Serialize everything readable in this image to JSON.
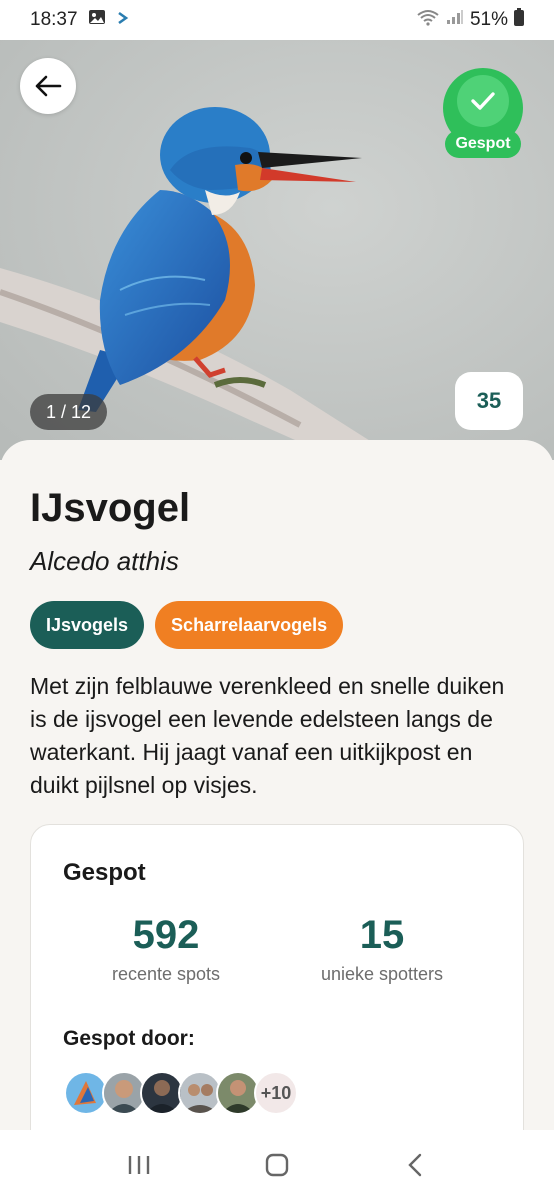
{
  "status_bar": {
    "time": "18:37",
    "battery": "51%",
    "icons": [
      "image-icon",
      "prompt-icon",
      "wifi-icon",
      "signal-icon",
      "battery-icon"
    ]
  },
  "hero": {
    "photo_counter": "1 / 12",
    "photo_count_chip": "35",
    "spotted_badge_label": "Gespot",
    "back_icon": "arrow-left-icon",
    "badge_icon": "check-icon"
  },
  "species": {
    "name": "IJsvogel",
    "latin_name": "Alcedo atthis",
    "tags": [
      {
        "label": "IJsvogels",
        "color": "#1b5e57"
      },
      {
        "label": "Scharrelaarvogels",
        "color": "#f07f22"
      }
    ],
    "description": "Met zijn felblauwe verenkleed en snelle duiken is de ijsvogel een levende edelsteen langs de waterkant. Hij jaagt vanaf een uitkijkpost en duikt pijlsnel op visjes."
  },
  "spotted_card": {
    "title": "Gespot",
    "stats": [
      {
        "value": "592",
        "label": "recente spots"
      },
      {
        "value": "15",
        "label": "unieke spotters"
      }
    ],
    "spotted_by_label": "Gespot door:",
    "more_count": "+10"
  },
  "nav_bar": {
    "buttons": [
      "recent-apps-icon",
      "home-icon",
      "back-icon"
    ]
  },
  "colors": {
    "accent": "#1b5e57",
    "orange": "#f07f22",
    "spotted_green": "#2fbf5a"
  }
}
